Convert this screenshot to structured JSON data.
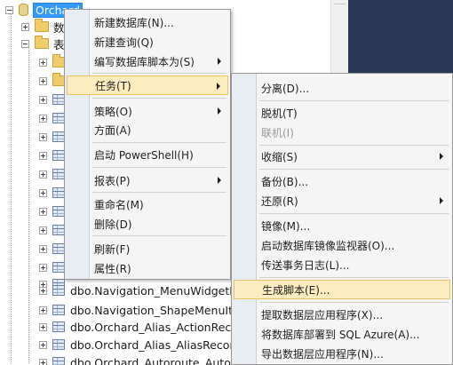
{
  "explorer": {
    "server_label": "Orchard",
    "folder_db_label": "数",
    "folder_table_label": "表",
    "tables": [
      "dbo.Navigation_MenuWidgetPa",
      "dbo.Navigation_ShapeMenuIte",
      "dbo.Orchard_Alias_ActionReco",
      "dbo.Orchard_Alias_AliasRecord",
      "dbo.Orchard_Autoroute_Autoro"
    ]
  },
  "context_menu": {
    "items": [
      {
        "label": "新建数据库(N)...",
        "submenu": false
      },
      {
        "label": "新建查询(Q)",
        "submenu": false
      },
      {
        "label": "编写数据库脚本为(S)",
        "submenu": true
      },
      {
        "label": "任务(T)",
        "submenu": true
      },
      {
        "label": "策略(O)",
        "submenu": true
      },
      {
        "label": "方面(A)",
        "submenu": false
      },
      {
        "label": "启动 PowerShell(H)",
        "submenu": false
      },
      {
        "label": "报表(P)",
        "submenu": true
      },
      {
        "label": "重命名(M)",
        "submenu": false
      },
      {
        "label": "删除(D)",
        "submenu": false
      },
      {
        "label": "刷新(F)",
        "submenu": false
      },
      {
        "label": "属性(R)",
        "submenu": false
      }
    ]
  },
  "tasks_menu": {
    "items": [
      {
        "label": "分离(D)...",
        "submenu": false
      },
      {
        "label": "脱机(T)",
        "submenu": false
      },
      {
        "label": "联机(I)",
        "submenu": false,
        "disabled": true
      },
      {
        "label": "收缩(S)",
        "submenu": true
      },
      {
        "label": "备份(B)...",
        "submenu": false
      },
      {
        "label": "还原(R)",
        "submenu": true
      },
      {
        "label": "镜像(M)...",
        "submenu": false
      },
      {
        "label": "启动数据库镜像监视器(O)...",
        "submenu": false
      },
      {
        "label": "传送事务日志(L)...",
        "submenu": false
      },
      {
        "label": "生成脚本(E)...",
        "submenu": false
      },
      {
        "label": "提取数据层应用程序(X)...",
        "submenu": false
      },
      {
        "label": "将数据库部署到 SQL Azure(A)...",
        "submenu": false
      },
      {
        "label": "导出数据层应用程序(N)...",
        "submenu": false
      }
    ]
  },
  "colors": {
    "highlight_bg": "#fcecbf",
    "highlight_border": "#e5c365",
    "selection_blue": "#3399ff",
    "dark_panel": "#293955"
  },
  "icons": [
    "database-icon",
    "folder-icon",
    "table-icon",
    "submenu-arrow-icon"
  ]
}
